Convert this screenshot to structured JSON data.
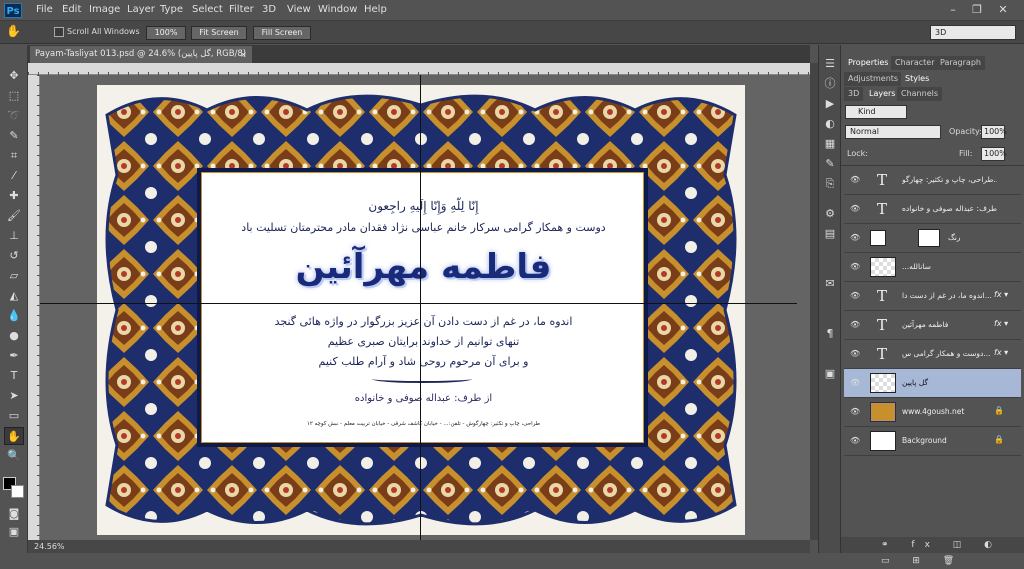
{
  "app": {
    "logo": "Ps",
    "menu": [
      "File",
      "Edit",
      "Image",
      "Layer",
      "Type",
      "Select",
      "Filter",
      "3D",
      "View",
      "Window",
      "Help"
    ]
  },
  "options": {
    "scroll_all": "Scroll All Windows",
    "zoom100": "100%",
    "fit": "Fit Screen",
    "fill": "Fill Screen",
    "workspace": "3D"
  },
  "document": {
    "tab_title": "Payam-Tasliyat 013.psd @ 24.6% (گل پایین, RGB/8) *",
    "zoom": "24.56%"
  },
  "artwork": {
    "line1": "إِنّا لِلّهِ وَإِنّا إِلَیهِ راجِعون",
    "line2": "دوست و همکار گرامی سرکار خانم عباسی نژاد فقدان مادر محترمتان تسلیت باد",
    "name": "فاطمه مهرآئین",
    "line3": "اندوه ما، در غم از دست دادن آن عزیز بزرگوار در واژه هائی گنجد",
    "line4": "تنهای توانیم از خداوند برایتان صبری عظیم",
    "line5": "و برای آن مرحوم روحی شاد و آرام طلب کنیم",
    "from": "از طرف: عبداله صوفی و خانواده",
    "footer": "طراحی، چاپ و تکثیر: چهارگوش - تلفن:... - خیابان کاشف شرقی - خیابان تربیت معلم - نبش کوچه ۱۲"
  },
  "panels": {
    "tabs1": [
      "Properties",
      "Character",
      "Paragraph"
    ],
    "tabs2": [
      "Adjustments",
      "Styles"
    ],
    "tabs3": [
      "3D",
      "Layers",
      "Channels"
    ],
    "kind": "Kind",
    "blend": "Normal",
    "opacity_label": "Opacity:",
    "opacity": "100%",
    "lock_label": "Lock:",
    "fill_label": "Fill:",
    "fill": "100%",
    "layers": [
      {
        "type": "text",
        "name": "طراحی، چاپ و تکثیر: چهارگو...",
        "fx": false
      },
      {
        "type": "text",
        "name": "از طرف: عبداله صوفی و خانواده",
        "fx": false
      },
      {
        "type": "adjust",
        "name": "رنگ",
        "fx": false
      },
      {
        "type": "image",
        "name": "...سانالله",
        "fx": false
      },
      {
        "type": "text",
        "name": "اندوه ما، در غم از دست دا...",
        "fx": true
      },
      {
        "type": "text",
        "name": "فاطمه مهرآئین",
        "fx": true
      },
      {
        "type": "text",
        "name": "دوست و همکار گرامی س...",
        "fx": true
      },
      {
        "type": "image",
        "name": "گل پایین",
        "fx": false,
        "selected": true
      },
      {
        "type": "image",
        "name": "www.4goush.net",
        "fx": false,
        "lock": true
      },
      {
        "type": "bg",
        "name": "Background",
        "fx": false,
        "lock": true
      }
    ]
  },
  "colors": {
    "navy": "#1e2d6b",
    "gold": "#c8902c",
    "selected": "#a6b8d6"
  }
}
